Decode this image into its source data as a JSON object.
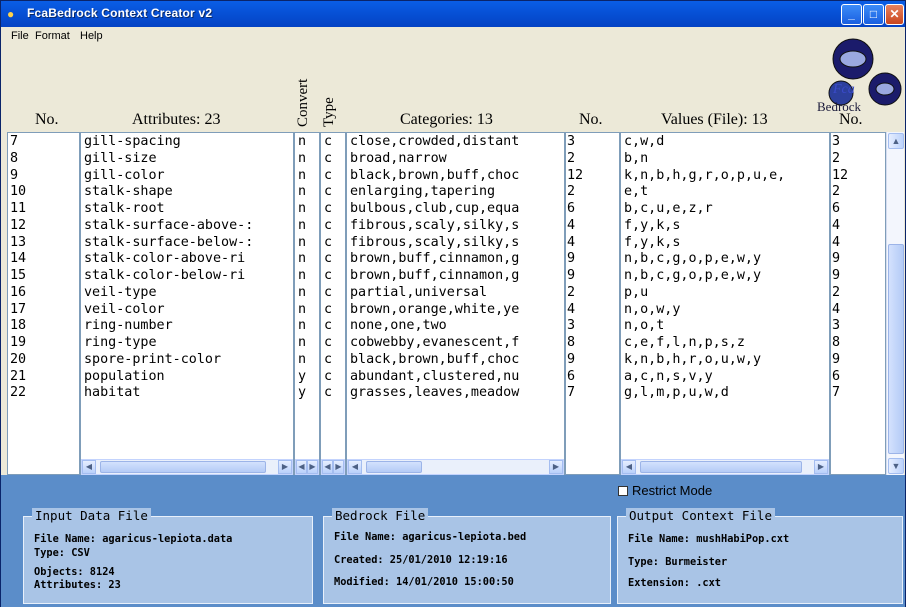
{
  "window": {
    "title": "FcaBedrock Context Creator v2"
  },
  "menu": [
    "File",
    "Format",
    "Help"
  ],
  "logo": {
    "line1": "Fca",
    "line2": "Bedrock"
  },
  "headers": {
    "no": "No.",
    "attributes": "Attributes: 23",
    "convert": "Convert",
    "type": "Type",
    "categories": "Categories: 13",
    "cat_no": "No.",
    "values": "Values (File): 13",
    "val_no": "No."
  },
  "rows": [
    {
      "no": "7",
      "attr": "gill-spacing",
      "conv": "n",
      "type": "c",
      "cats": "close,crowded,distant",
      "ncat": "3",
      "vals": "c,w,d",
      "nval": "3"
    },
    {
      "no": "8",
      "attr": "gill-size",
      "conv": "n",
      "type": "c",
      "cats": "broad,narrow",
      "ncat": "2",
      "vals": "b,n",
      "nval": "2"
    },
    {
      "no": "9",
      "attr": "gill-color",
      "conv": "n",
      "type": "c",
      "cats": "black,brown,buff,choc",
      "ncat": "12",
      "vals": "k,n,b,h,g,r,o,p,u,e,",
      "nval": "12"
    },
    {
      "no": "10",
      "attr": "stalk-shape",
      "conv": "n",
      "type": "c",
      "cats": "enlarging,tapering",
      "ncat": "2",
      "vals": "e,t",
      "nval": "2"
    },
    {
      "no": "11",
      "attr": "stalk-root",
      "conv": "n",
      "type": "c",
      "cats": "bulbous,club,cup,equa",
      "ncat": "6",
      "vals": "b,c,u,e,z,r",
      "nval": "6"
    },
    {
      "no": "12",
      "attr": "stalk-surface-above-:",
      "conv": "n",
      "type": "c",
      "cats": "fibrous,scaly,silky,s",
      "ncat": "4",
      "vals": "f,y,k,s",
      "nval": "4"
    },
    {
      "no": "13",
      "attr": "stalk-surface-below-:",
      "conv": "n",
      "type": "c",
      "cats": "fibrous,scaly,silky,s",
      "ncat": "4",
      "vals": "f,y,k,s",
      "nval": "4"
    },
    {
      "no": "14",
      "attr": "stalk-color-above-ri",
      "conv": "n",
      "type": "c",
      "cats": "brown,buff,cinnamon,g",
      "ncat": "9",
      "vals": "n,b,c,g,o,p,e,w,y",
      "nval": "9"
    },
    {
      "no": "15",
      "attr": "stalk-color-below-ri",
      "conv": "n",
      "type": "c",
      "cats": "brown,buff,cinnamon,g",
      "ncat": "9",
      "vals": "n,b,c,g,o,p,e,w,y",
      "nval": "9"
    },
    {
      "no": "16",
      "attr": "veil-type",
      "conv": "n",
      "type": "c",
      "cats": "partial,universal",
      "ncat": "2",
      "vals": "p,u",
      "nval": "2"
    },
    {
      "no": "17",
      "attr": "veil-color",
      "conv": "n",
      "type": "c",
      "cats": "brown,orange,white,ye",
      "ncat": "4",
      "vals": "n,o,w,y",
      "nval": "4"
    },
    {
      "no": "18",
      "attr": "ring-number",
      "conv": "n",
      "type": "c",
      "cats": "none,one,two",
      "ncat": "3",
      "vals": "n,o,t",
      "nval": "3"
    },
    {
      "no": "19",
      "attr": "ring-type",
      "conv": "n",
      "type": "c",
      "cats": "cobwebby,evanescent,f",
      "ncat": "8",
      "vals": "c,e,f,l,n,p,s,z",
      "nval": "8"
    },
    {
      "no": "20",
      "attr": "spore-print-color",
      "conv": "n",
      "type": "c",
      "cats": "black,brown,buff,choc",
      "ncat": "9",
      "vals": "k,n,b,h,r,o,u,w,y",
      "nval": "9"
    },
    {
      "no": "21",
      "attr": "population",
      "conv": "y",
      "type": "c",
      "cats": "abundant,clustered,nu",
      "ncat": "6",
      "vals": "a,c,n,s,v,y",
      "nval": "6"
    },
    {
      "no": "22",
      "attr": "habitat",
      "conv": "y",
      "type": "c",
      "cats": "grasses,leaves,meadow",
      "ncat": "7",
      "vals": "g,l,m,p,u,w,d",
      "nval": "7"
    }
  ],
  "restrict_mode": {
    "label": "Restrict Mode",
    "checked": false
  },
  "input_file": {
    "title": "Input Data File",
    "lines": [
      "File Name: agaricus-lepiota.data",
      "Type: CSV",
      "Objects: 8124",
      "Attributes: 23"
    ]
  },
  "bedrock_file": {
    "title": "Bedrock File",
    "lines": [
      "File Name: agaricus-lepiota.bed",
      "Created: 25/01/2010 12:19:16",
      "Modified: 14/01/2010 15:00:50"
    ]
  },
  "output_file": {
    "title": "Output Context File",
    "lines": [
      "File Name: mushHabiPop.cxt",
      "Type: Burmeister",
      "Extension: .cxt"
    ]
  },
  "colors": {
    "title_bar": "#0751d6",
    "frame_bg": "#ece9d8",
    "bottom_bg": "#5b8dc9",
    "group_bg": "#a9c4e6"
  }
}
